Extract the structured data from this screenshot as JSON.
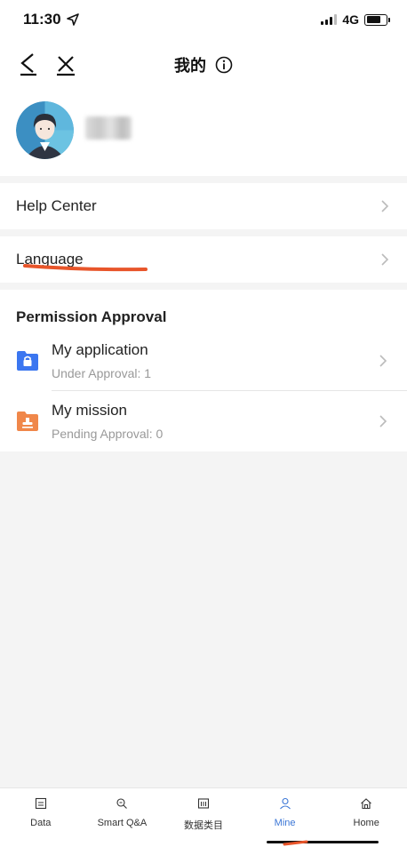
{
  "status_bar": {
    "time": "11:30",
    "network": "4G"
  },
  "nav": {
    "title": "我的"
  },
  "menu": {
    "help_center": "Help Center",
    "language": "Language"
  },
  "permission": {
    "title": "Permission Approval",
    "my_application": {
      "label": "My application",
      "status": "Under Approval: 1"
    },
    "my_mission": {
      "label": "My mission",
      "status": "Pending Approval: 0"
    }
  },
  "tabs": [
    {
      "label": "Data",
      "icon": "data-icon"
    },
    {
      "label": "Smart Q&A",
      "icon": "smart-qa-icon"
    },
    {
      "label": "数据类目",
      "icon": "category-icon"
    },
    {
      "label": "Mine",
      "icon": "user-icon"
    },
    {
      "label": "Home",
      "icon": "home-icon"
    }
  ],
  "colors": {
    "accent": "#3b76d6",
    "application_icon": "#3b76f0",
    "mission_icon": "#f0874a",
    "annotation": "#e8552a"
  }
}
